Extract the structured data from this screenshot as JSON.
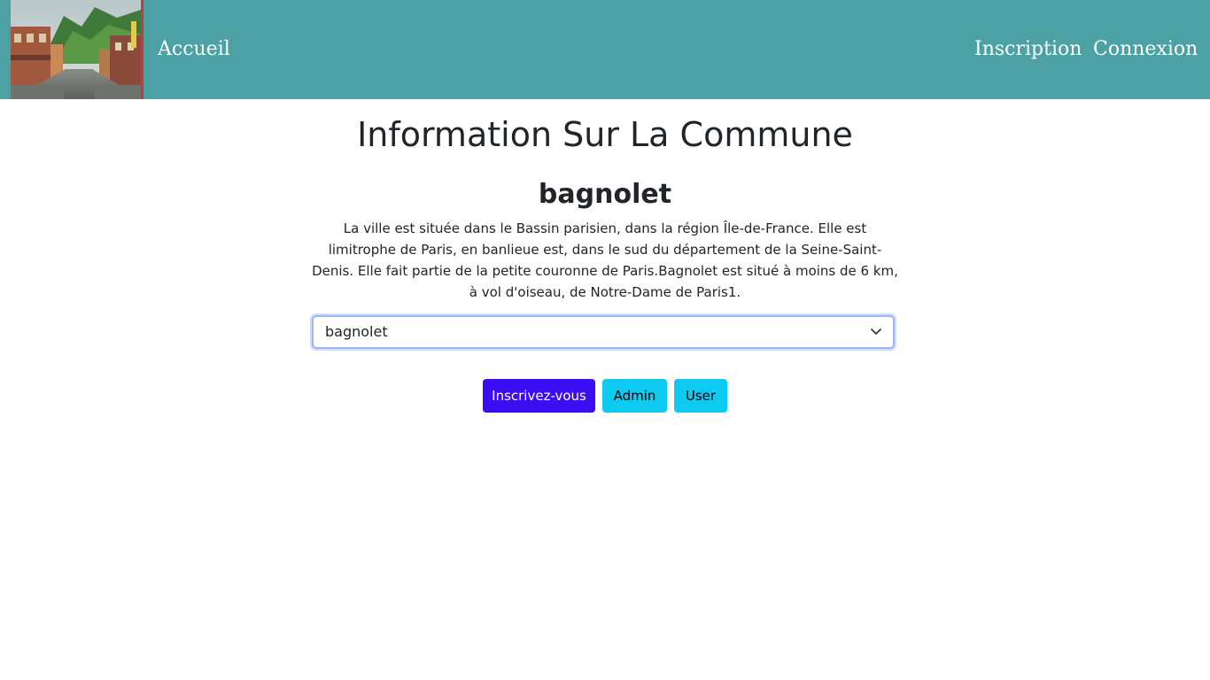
{
  "nav": {
    "home_label": "Accueil",
    "signup_label": "Inscription",
    "login_label": "Connexion",
    "background_color": "#4ba1a3"
  },
  "main": {
    "title": "Information Sur La Commune",
    "commune_name": "bagnolet",
    "description": "La ville est située dans le Bassin parisien, dans la région Île-de-France. Elle est limitrophe de Paris, en banlieue est, dans le sud du département de la Seine-Saint-Denis. Elle fait partie de la petite couronne de Paris.Bagnolet est situé à moins de 6 km, à vol d'oiseau, de Notre-Dame de Paris1.",
    "select": {
      "selected_value": "bagnolet"
    },
    "buttons": {
      "register_label": "Inscrivez-vous",
      "admin_label": "Admin",
      "user_label": "User"
    },
    "colors": {
      "primary_button": "#3b0df2",
      "info_button": "#0dcaf0"
    }
  }
}
